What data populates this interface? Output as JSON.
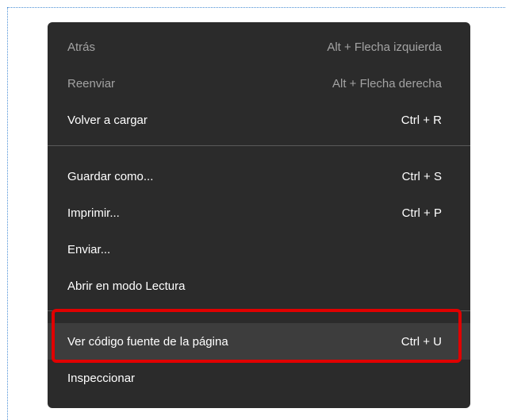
{
  "menu": {
    "items": [
      {
        "label": "Atrás",
        "shortcut": "Alt + Flecha izquierda",
        "disabled": true
      },
      {
        "label": "Reenviar",
        "shortcut": "Alt + Flecha derecha",
        "disabled": true
      },
      {
        "label": "Volver a cargar",
        "shortcut": "Ctrl + R",
        "disabled": false
      },
      {
        "label": "Guardar como...",
        "shortcut": "Ctrl + S",
        "disabled": false
      },
      {
        "label": "Imprimir...",
        "shortcut": "Ctrl + P",
        "disabled": false
      },
      {
        "label": "Enviar...",
        "shortcut": "",
        "disabled": false
      },
      {
        "label": "Abrir en modo Lectura",
        "shortcut": "",
        "disabled": false
      },
      {
        "label": "Ver código fuente de la página",
        "shortcut": "Ctrl + U",
        "disabled": false,
        "hovered": true
      },
      {
        "label": "Inspeccionar",
        "shortcut": "",
        "disabled": false
      }
    ]
  },
  "colors": {
    "menu_background": "#2b2b2b",
    "hover_background": "#3d3d3d",
    "highlight_border": "#e00000",
    "disabled_text": "#a3a3a3",
    "text": "#ffffff"
  }
}
